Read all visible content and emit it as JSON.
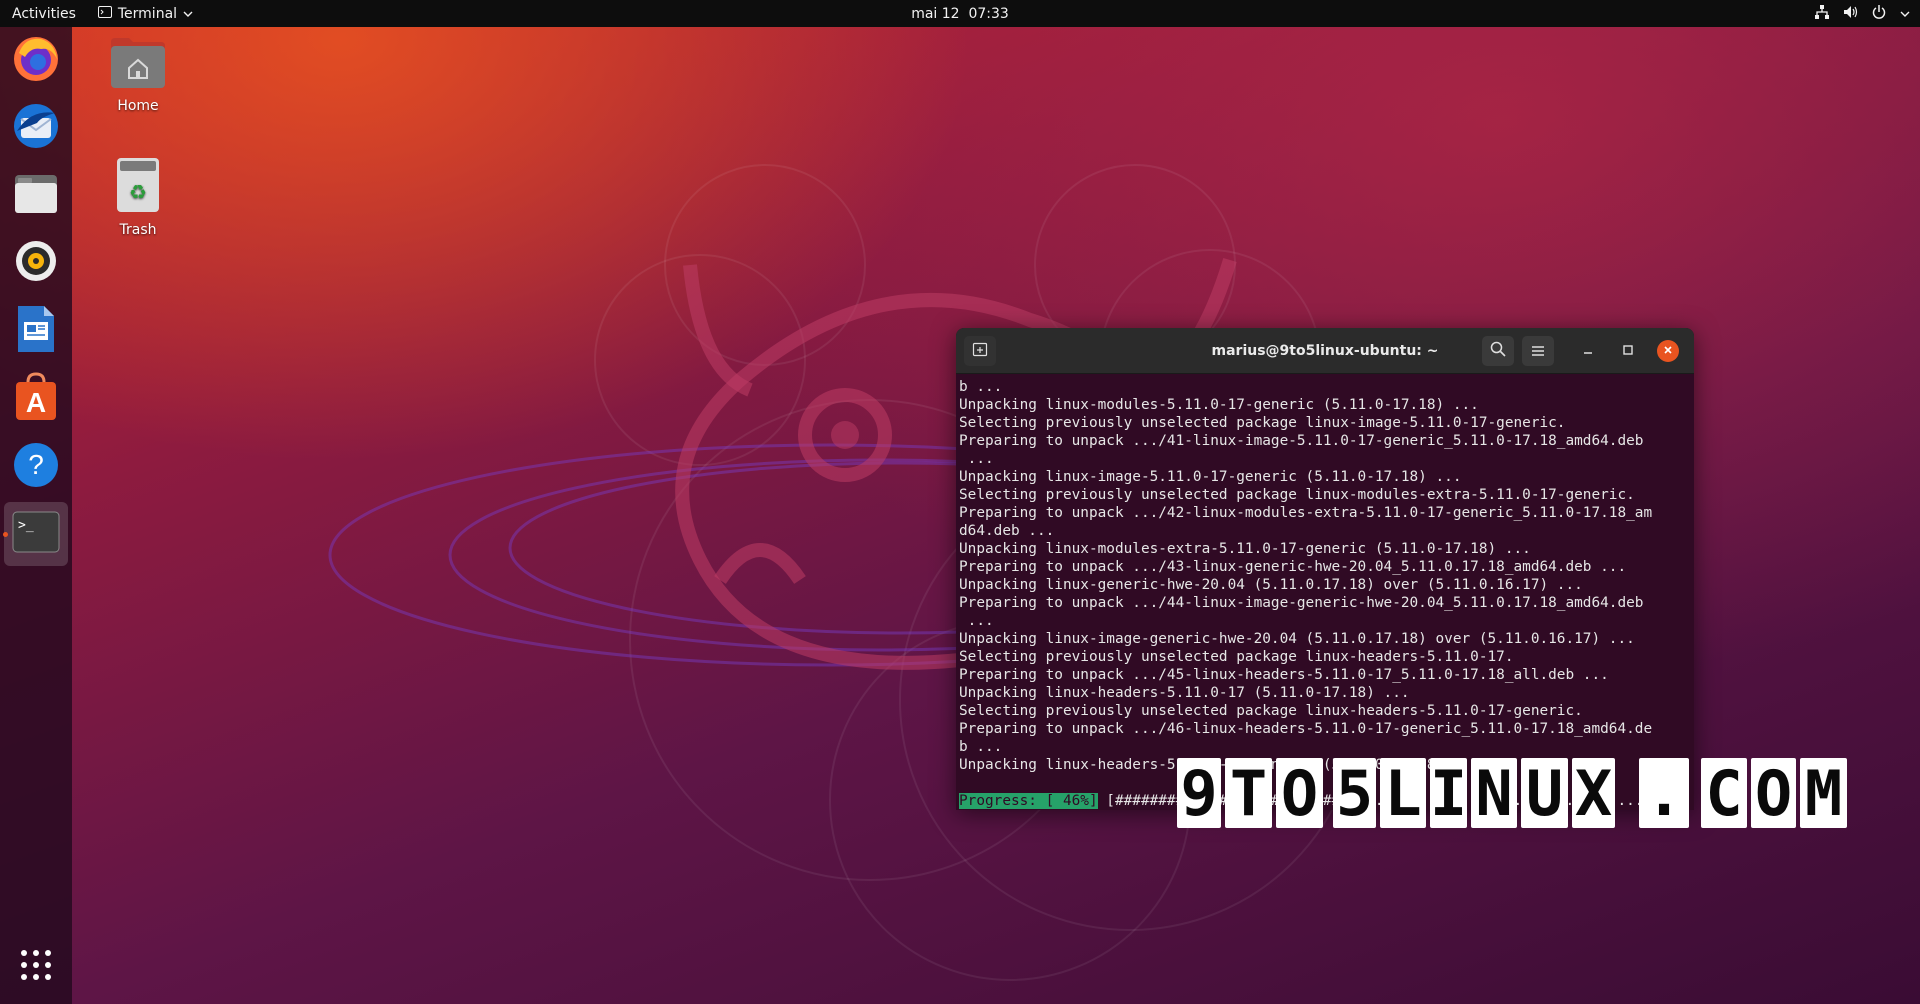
{
  "topbar": {
    "activities": "Activities",
    "app_name": "Terminal",
    "clock": "mai 12  07:33",
    "tray_icons": [
      "network-icon",
      "volume-icon",
      "power-icon",
      "chevron-down-icon"
    ]
  },
  "dock": {
    "items": [
      {
        "name": "firefox",
        "icon": "firefox-icon"
      },
      {
        "name": "thunderbird",
        "icon": "thunderbird-icon"
      },
      {
        "name": "files",
        "icon": "files-icon"
      },
      {
        "name": "rhythmbox",
        "icon": "rhythmbox-icon"
      },
      {
        "name": "libreoffice-writer",
        "icon": "writer-icon"
      },
      {
        "name": "ubuntu-software",
        "icon": "software-icon"
      },
      {
        "name": "help",
        "icon": "help-icon",
        "glyph": "?"
      },
      {
        "name": "terminal",
        "icon": "terminal-icon",
        "glyph": ">_",
        "active": true
      }
    ],
    "show_apps_icon": "app-grid-icon"
  },
  "desktop": {
    "home_label": "Home",
    "trash_label": "Trash"
  },
  "terminal": {
    "title": "marius@9to5linux-ubuntu: ~",
    "lines": [
      "b ...",
      "Unpacking linux-modules-5.11.0-17-generic (5.11.0-17.18) ...",
      "Selecting previously unselected package linux-image-5.11.0-17-generic.",
      "Preparing to unpack .../41-linux-image-5.11.0-17-generic_5.11.0-17.18_amd64.deb",
      " ...",
      "Unpacking linux-image-5.11.0-17-generic (5.11.0-17.18) ...",
      "Selecting previously unselected package linux-modules-extra-5.11.0-17-generic.",
      "Preparing to unpack .../42-linux-modules-extra-5.11.0-17-generic_5.11.0-17.18_am",
      "d64.deb ...",
      "Unpacking linux-modules-extra-5.11.0-17-generic (5.11.0-17.18) ...",
      "Preparing to unpack .../43-linux-generic-hwe-20.04_5.11.0.17.18_amd64.deb ...",
      "Unpacking linux-generic-hwe-20.04 (5.11.0.17.18) over (5.11.0.16.17) ...",
      "Preparing to unpack .../44-linux-image-generic-hwe-20.04_5.11.0.17.18_amd64.deb",
      " ...",
      "Unpacking linux-image-generic-hwe-20.04 (5.11.0.17.18) over (5.11.0.16.17) ...",
      "Selecting previously unselected package linux-headers-5.11.0-17.",
      "Preparing to unpack .../45-linux-headers-5.11.0-17_5.11.0-17.18_all.deb ...",
      "Unpacking linux-headers-5.11.0-17 (5.11.0-17.18) ...",
      "Selecting previously unselected package linux-headers-5.11.0-17-generic.",
      "Preparing to unpack .../46-linux-headers-5.11.0-17-generic_5.11.0-17.18_amd64.de",
      "b ...",
      "Unpacking linux-headers-5.11.0-17-generic (5.11.0-17.18) ...",
      ""
    ],
    "progress_label": "Progress: [ 46%]",
    "progress_bar": "[##############################..................................]",
    "progress_value": 0.46
  },
  "watermark": {
    "tiles": [
      "9",
      "T",
      "O",
      "5",
      "L",
      "I",
      "N",
      "U",
      "X",
      ".",
      "C",
      "O",
      "M"
    ]
  },
  "colors": {
    "ubuntu_orange": "#e95420",
    "terminal_bg": "#300a24",
    "progress_green": "#26a269",
    "close_button": "#e95420"
  }
}
